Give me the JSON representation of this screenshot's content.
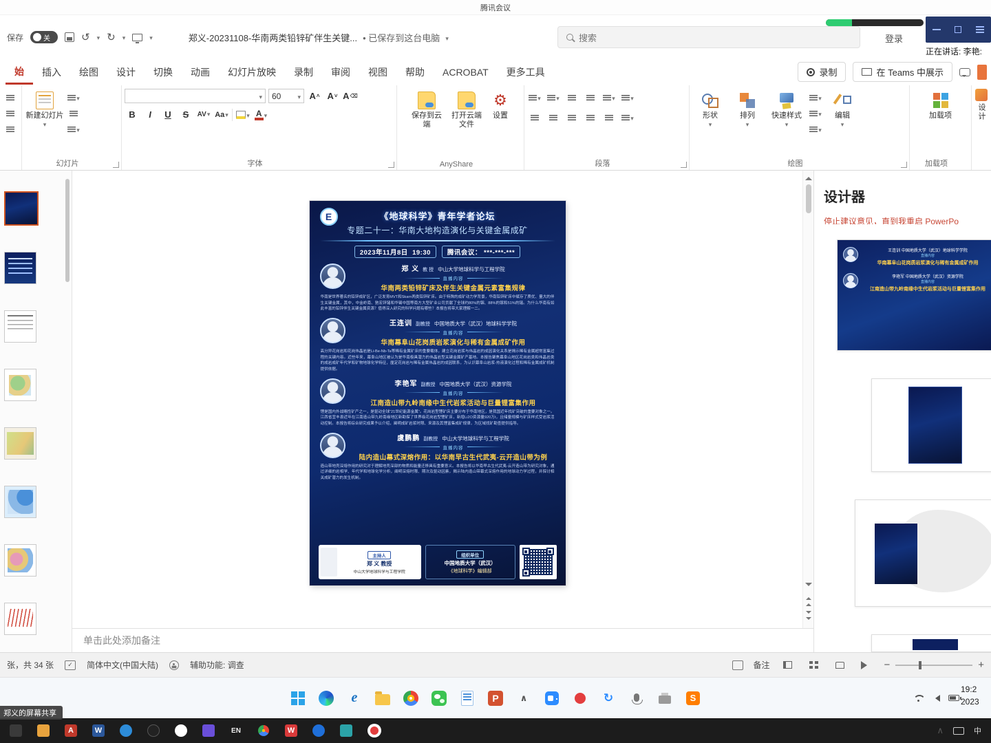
{
  "meeting": {
    "title": "腾讯会议",
    "speaking": "正在讲话: 李艳:",
    "share_tag": "郑义的屏幕共享"
  },
  "title_bar": {
    "autosave_label": "保存",
    "autosave_state": "关",
    "doc_title": "郑义-20231108-华南两类铅锌矿伴生关键...",
    "save_status": "• 已保存到这台电脑",
    "search_placeholder": "搜索",
    "login_label": "登录"
  },
  "ribbon": {
    "tabs": [
      "始",
      "插入",
      "绘图",
      "设计",
      "切换",
      "动画",
      "幻灯片放映",
      "录制",
      "审阅",
      "视图",
      "帮助",
      "ACROBAT",
      "更多工具"
    ],
    "record_button": "录制",
    "teams_button": "在 Teams 中展示",
    "groups": {
      "slides": {
        "label": "幻灯片",
        "new_slide": "新建幻灯片"
      },
      "font": {
        "label": "字体",
        "size": "60",
        "bold": "B",
        "italic": "I",
        "underline": "U",
        "strike": "S",
        "spacing": "AV",
        "case": "Aa",
        "color_letter": "A"
      },
      "anyshare": {
        "label": "AnyShare",
        "save_cloud": "保存到云端",
        "open_cloud": "打开云端文件",
        "settings": "设置"
      },
      "paragraph": {
        "label": "段落"
      },
      "drawing": {
        "label": "绘图",
        "shapes": "形状",
        "arrange": "排列",
        "quick_styles": "快速样式",
        "edit": "编辑"
      },
      "addins": {
        "label": "加载项",
        "button": "加载项"
      },
      "designer_button": "设计"
    }
  },
  "designer": {
    "title": "设计器",
    "notice": "停止建议意见，直到我重启 PowerPo"
  },
  "slide": {
    "logo_text": "E",
    "forum_title": "《地球科学》青年学者论坛",
    "topic_title": "专题二十一：华南大地构造演化与关键金属成矿",
    "date": "2023年11月8日",
    "time": "19:30",
    "meeting_chip": "腾讯会议： ***-***-***",
    "live_label": "直播内容",
    "speakers": [
      {
        "name": "郑 义",
        "title": "教 授",
        "affiliation": "中山大学地球科学与工程学院",
        "talk": "华南两类铅锌矿床及伴生关键金属元素富集规律",
        "abstract": "华南是世界著名的铅锌成矿区，广泛发育MVT和Skarn两类铅锌矿床。由于特殊的成矿动力学背景，华南铅锌矿床中赋存了质优、量大的伴生关键金属，其中，中金岭南、驰宏锌锗和华锡中国等南方大型矿业公司贡献了全球约80%的铟、88%的镓和51%的锗。为什么华南有如此丰富的铅锌伴生关键金属资源？值得深入研究的科学问题有哪些？本报告将带大家理解一二。"
      },
      {
        "name": "王连训",
        "title": "副教授",
        "affiliation": "中国地质大学（武汉）地球科学学院",
        "talk": "华南幕阜山花岗质岩浆演化与稀有金属成矿作用",
        "abstract": "高分异花岗岩和花岗伟晶岩是Li-Be-Nb-Ta等稀有金属矿床的重要载体，建立花岗岩浆与伟晶岩的成因演化关系是揭示稀有金属超常富集过程的关键内容。近些年来，幕阜山地区被认为是华南极具潜力的伟晶岩型关键金属矿产基地。本报告聚焦幕阜山地区花岗岩类和伟晶岩类的成岩成矿年代学和矿物地球化学特征，厘定花岗岩与稀有金属伟晶岩的成因联系，为认识幕阜山岩浆-热液演化过程和稀有金属成矿机制提供依据。"
      },
      {
        "name": "李艳军",
        "title": "副教授",
        "affiliation": "中国地质大学（武汉）资源学院",
        "talk": "江南造山带九岭南缘中生代岩浆活动与巨量锂富集作用",
        "abstract": "锂是国内外战略性矿产之一，是驱动全球“21世纪能源金属”。花岗岩型锂矿床主要分布于华南地区，是我国近年找矿突破的重要对象之一。江西省宜丰县近年在江南造山带九岭南缘地区新勘探了世界级花岗岩型锂矿床，新增Li2O资源量920万t，且储量规模与矿床样式受岩浆活动控制。本报告将综合研究成果予以介绍，阐明成矿岩浆时限、来源及其锂富集成矿规律，为区域找矿勘查提供指导。"
      },
      {
        "name": "虞鹏鹏",
        "title": "副教授",
        "affiliation": "中山大学地球科学与工程学院",
        "talk": "陆内造山幕式深熔作用：以华南早古生代武夷-云开造山带为例",
        "abstract": "造山带地壳深熔作用的研究对于理解地壳深部的物质和能量迁移具有重要意义。本报告将以华南早古生代武夷-云开造山带为研究对象，通过详细的岩相学、年代学和地球化学分析，阐明深熔时限、期次及驱动因素，揭示陆内造山带幕式深熔作用的地球动力学过程，并探讨相关成矿潜力的发生机制。"
      }
    ],
    "host_label": "主持人",
    "host_name": "郑 义 教授",
    "host_affiliation": "中山大学地球科学与工程学院",
    "org_label": "组织单位",
    "org_line1": "中国地质大学（武汉）",
    "org_line2": "《地球科学》编辑部"
  },
  "notes": {
    "placeholder": "单击此处添加备注"
  },
  "status_bar": {
    "slide_count": "张，共 34 张",
    "language": "简体中文(中国大陆)",
    "accessibility": "辅助功能: 调查",
    "notes_button": "备注"
  },
  "taskbar": {
    "clock_time": "19:2",
    "clock_date": "2023",
    "en_badge": "EN",
    "lang_badge": "中"
  }
}
